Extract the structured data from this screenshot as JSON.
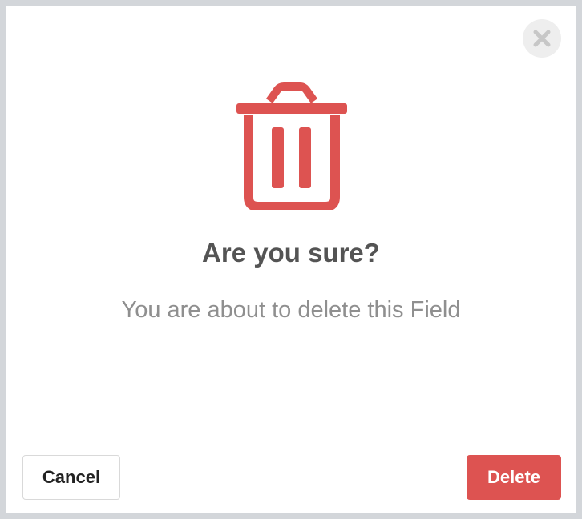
{
  "dialog": {
    "title": "Are you sure?",
    "message": "You are about to delete this Field",
    "icon": "trash-icon",
    "close_icon": "close-icon",
    "accent_color": "#dd5351"
  },
  "buttons": {
    "cancel_label": "Cancel",
    "delete_label": "Delete"
  }
}
